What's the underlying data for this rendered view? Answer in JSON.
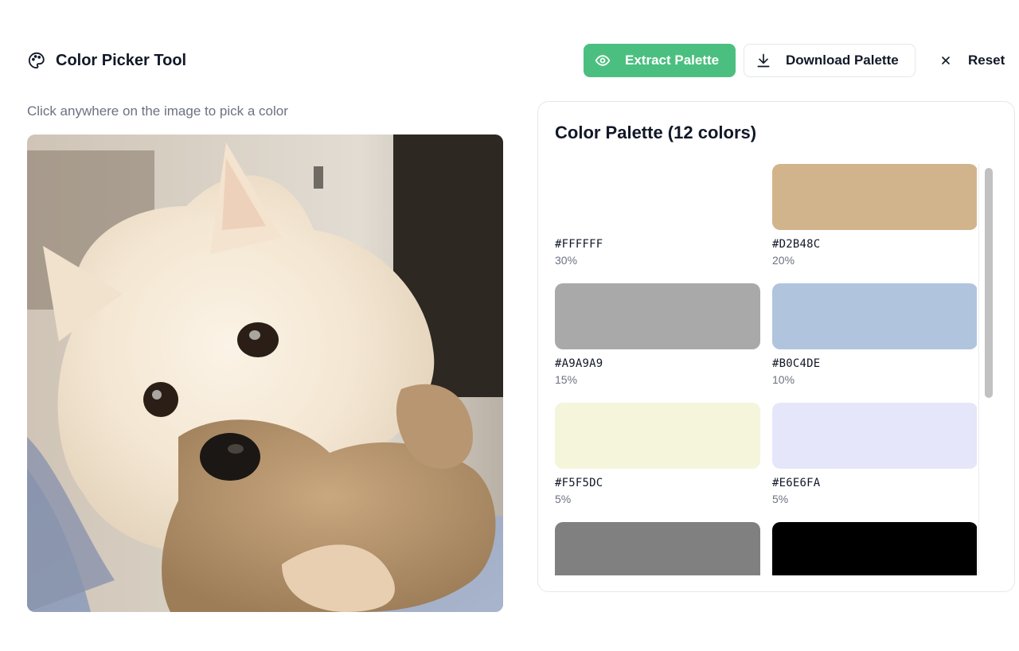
{
  "app": {
    "title": "Color Picker Tool",
    "title_icon": "palette-icon"
  },
  "toolbar": {
    "extract_label": "Extract Palette",
    "extract_icon": "eye-icon",
    "download_label": "Download Palette",
    "download_icon": "download-icon",
    "reset_label": "Reset",
    "reset_icon": "close-icon",
    "accent_color": "#4BBF7F"
  },
  "main": {
    "instruction": "Click anywhere on the image to pick a color"
  },
  "palette": {
    "title": "Color Palette (12 colors)",
    "colors": [
      {
        "hex": "#FFFFFF",
        "percent": "30%"
      },
      {
        "hex": "#D2B48C",
        "percent": "20%"
      },
      {
        "hex": "#A9A9A9",
        "percent": "15%"
      },
      {
        "hex": "#B0C4DE",
        "percent": "10%"
      },
      {
        "hex": "#F5F5DC",
        "percent": "5%"
      },
      {
        "hex": "#E6E6FA",
        "percent": "5%"
      },
      {
        "hex": "#808080",
        "percent": ""
      },
      {
        "hex": "#000000",
        "percent": ""
      }
    ],
    "scroll_fraction_visible": 0.57
  }
}
